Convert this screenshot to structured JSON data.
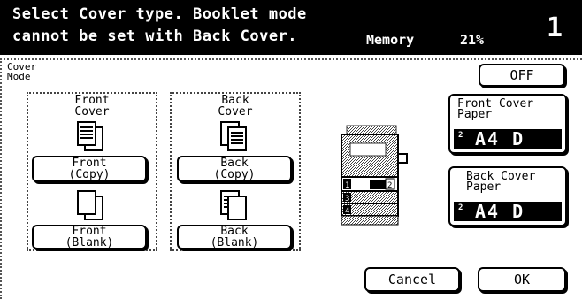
{
  "header": {
    "line1": "Select Cover type. Booklet mode",
    "line2": "cannot be set with Back Cover.",
    "memory_label": "Memory",
    "memory_value": "21%",
    "page_number": "1"
  },
  "mode_title": [
    "Cover",
    "Mode"
  ],
  "front_cover": {
    "title": [
      "Front",
      "Cover"
    ],
    "copy_button": [
      "Front",
      "(Copy)"
    ],
    "blank_button": [
      "Front",
      "(Blank)"
    ]
  },
  "back_cover": {
    "title": [
      "Back",
      "Cover"
    ],
    "copy_button": [
      "Back",
      "(Copy)"
    ],
    "blank_button": [
      "Back",
      "(Blank)"
    ]
  },
  "off_button": "OFF",
  "front_cover_paper": {
    "label": [
      "Front Cover",
      "Paper"
    ],
    "tray": "2",
    "size": "A4 D"
  },
  "back_cover_paper": {
    "label": [
      "Back Cover",
      "Paper"
    ],
    "tray": "2",
    "size": "A4 D"
  },
  "machine": {
    "tray_labels": [
      "1",
      "2",
      "3",
      "4"
    ],
    "output_label": "3"
  },
  "cancel_button": "Cancel",
  "ok_button": "OK"
}
